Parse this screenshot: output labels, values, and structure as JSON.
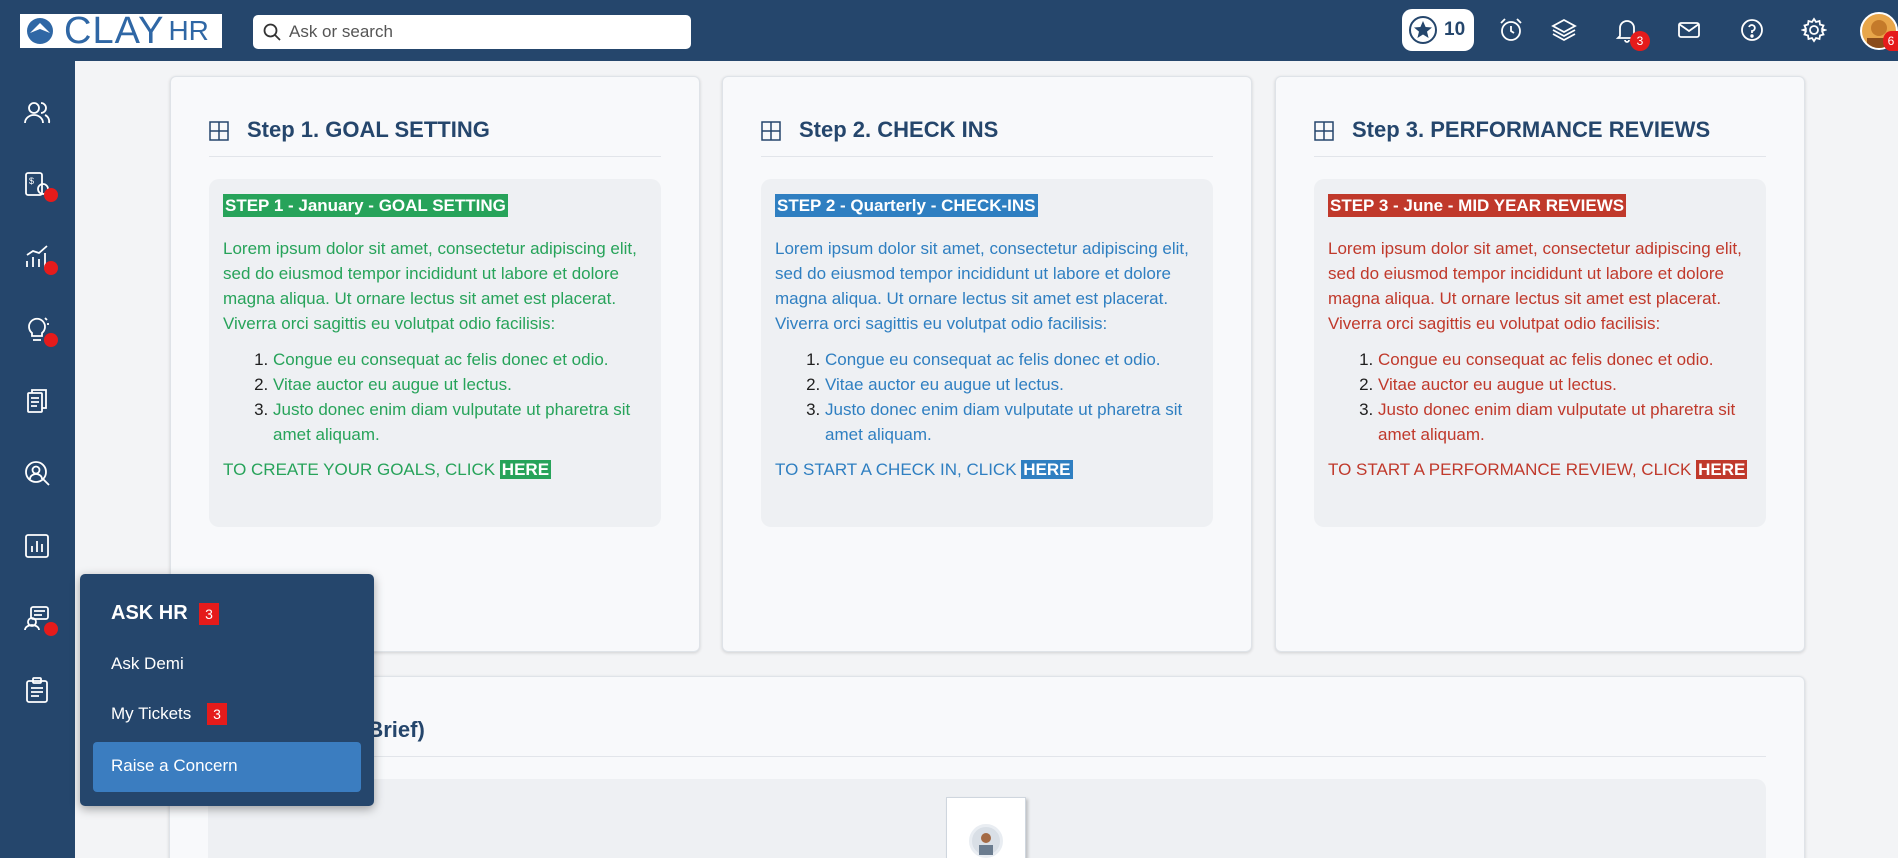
{
  "header": {
    "logo_text": "CLAY",
    "logo_suffix": "HR",
    "search_placeholder": "Ask or search",
    "points": "10",
    "notifications_count": "3",
    "avatar_badge": "6",
    "icons": [
      "star-icon",
      "alarm-icon",
      "layers-icon",
      "bell-icon",
      "mail-icon",
      "help-icon",
      "gear-icon"
    ]
  },
  "sidebar": {
    "items": [
      {
        "icon": "people-icon",
        "dot": false
      },
      {
        "icon": "payroll-icon",
        "dot": true
      },
      {
        "icon": "growth-chart-icon",
        "dot": true
      },
      {
        "icon": "lightbulb-icon",
        "dot": true
      },
      {
        "icon": "documents-icon",
        "dot": false
      },
      {
        "icon": "search-person-icon",
        "dot": false
      },
      {
        "icon": "report-icon",
        "dot": false
      },
      {
        "icon": "support-icon",
        "dot": true
      },
      {
        "icon": "clipboard-icon",
        "dot": false
      }
    ]
  },
  "cards": [
    {
      "title": "Step 1. GOAL SETTING",
      "tag": "STEP 1 - January - GOAL SETTING",
      "color": "#27a35a",
      "intro": "Lorem ipsum dolor sit amet, consectetur adipiscing elit, sed do eiusmod tempor incididunt ut labore et dolore magna aliqua. Ut ornare lectus sit amet est placerat. Viverra orci sagittis eu volutpat odio facilisis:",
      "list": [
        "Congue eu consequat ac felis donec et odio.",
        "Vitae auctor eu augue ut lectus.",
        "Justo donec enim diam vulputate ut pharetra sit amet aliquam."
      ],
      "cta": "TO CREATE YOUR GOALS, CLICK ",
      "cta_link": "HERE"
    },
    {
      "title": "Step 2. CHECK INS",
      "tag": "STEP 2 - Quarterly -  CHECK-INS",
      "color": "#2f7fc1",
      "intro": "Lorem ipsum dolor sit amet, consectetur adipiscing elit, sed do eiusmod tempor incididunt ut labore et dolore magna aliqua. Ut ornare lectus sit amet est placerat. Viverra orci sagittis eu volutpat odio facilisis:",
      "list": [
        "Congue eu consequat ac felis donec et odio.",
        "Vitae auctor eu augue ut lectus.",
        "Justo donec enim diam vulputate ut pharetra sit amet aliquam."
      ],
      "cta": "TO START A CHECK IN, CLICK ",
      "cta_link": "HERE"
    },
    {
      "title": "Step 3. PERFORMANCE REVIEWS",
      "tag": "STEP 3 - June - MID YEAR REVIEWS",
      "color": "#c0392b",
      "intro": "Lorem ipsum dolor sit amet, consectetur adipiscing elit, sed do eiusmod tempor incididunt ut labore et dolore magna aliqua. Ut ornare lectus sit amet est placerat. Viverra orci sagittis eu volutpat odio facilisis:",
      "list": [
        "Congue eu consequat ac felis donec et odio.",
        "Vitae auctor eu augue ut lectus.",
        "Justo donec enim diam vulputate ut pharetra sit amet aliquam."
      ],
      "cta": "TO START A PERFORMANCE REVIEW, CLICK ",
      "cta_link": "HERE"
    }
  ],
  "org_card": {
    "title_visible": "rt (Brief)"
  },
  "popup": {
    "title": "ASK HR",
    "title_badge": "3",
    "items": [
      {
        "label": "Ask Demi"
      },
      {
        "label": "My Tickets",
        "badge": "3"
      },
      {
        "label": "Raise a Concern",
        "active": true
      }
    ]
  }
}
